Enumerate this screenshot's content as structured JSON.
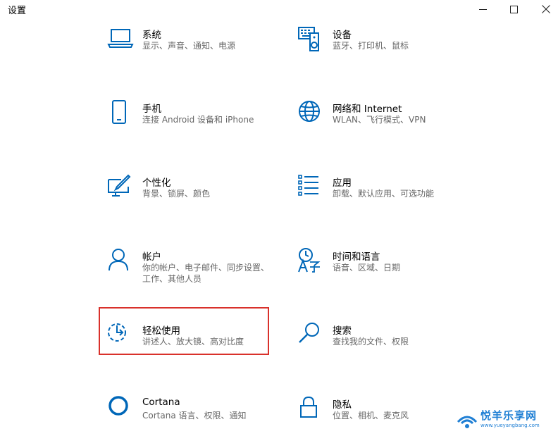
{
  "window": {
    "title": "设置",
    "accent_color": "#0067b8",
    "minimize_icon": "minimize-icon",
    "maximize_icon": "maximize-icon",
    "close_icon": "close-icon"
  },
  "tiles": [
    {
      "title": "系统",
      "desc": "显示、声音、通知、电源",
      "icon": "laptop-icon"
    },
    {
      "title": "设备",
      "desc": "蓝牙、打印机、鼠标",
      "icon": "keyboard-speaker-icon"
    },
    {
      "title": "手机",
      "desc": "连接 Android 设备和 iPhone",
      "icon": "phone-icon"
    },
    {
      "title": "网络和 Internet",
      "desc": "WLAN、飞行模式、VPN",
      "icon": "globe-icon"
    },
    {
      "title": "个性化",
      "desc": "背景、锁屏、颜色",
      "icon": "paint-icon"
    },
    {
      "title": "应用",
      "desc": "卸载、默认应用、可选功能",
      "icon": "apps-list-icon"
    },
    {
      "title": "帐户",
      "desc": "你的帐户、电子邮件、同步设置、工作、其他人员",
      "icon": "person-icon"
    },
    {
      "title": "时间和语言",
      "desc": "语音、区域、日期",
      "icon": "time-language-icon"
    },
    {
      "title": "轻松使用",
      "desc": "讲述人、放大镜、高对比度",
      "icon": "ease-of-access-icon"
    },
    {
      "title": "搜索",
      "desc": "查找我的文件、权限",
      "icon": "search-icon"
    },
    {
      "title": "Cortana",
      "desc": "Cortana 语言、权限、通知",
      "icon": "cortana-icon"
    },
    {
      "title": "隐私",
      "desc": "位置、相机、麦克风",
      "icon": "lock-icon"
    }
  ],
  "highlight": {
    "target": "轻松使用",
    "color": "#d9312b"
  },
  "watermark": {
    "text": "悦羊乐享网",
    "url": "www.yueyangbang.com"
  }
}
